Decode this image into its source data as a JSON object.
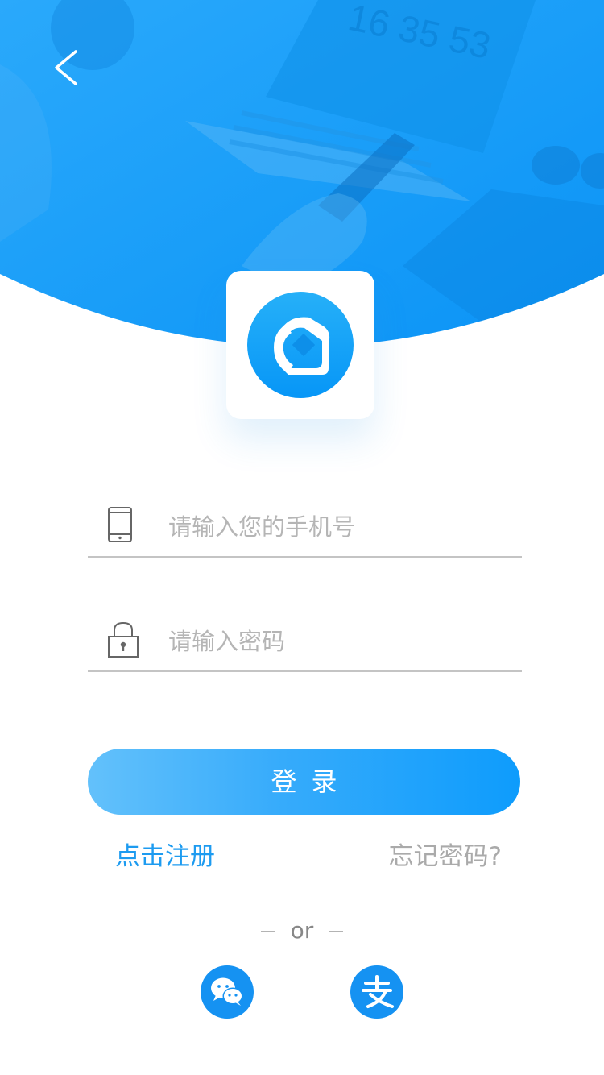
{
  "hero": {
    "background_clock_text": "16 35 53",
    "background_color": "#1a9ffa"
  },
  "header": {
    "back_icon": "chevron-left-icon"
  },
  "logo": {
    "icon": "app-logo-icon",
    "color": "#119df9"
  },
  "form": {
    "phone": {
      "icon": "mobile-phone-icon",
      "placeholder": "请输入您的手机号",
      "value": ""
    },
    "password": {
      "icon": "lock-icon",
      "placeholder": "请输入密码",
      "value": ""
    },
    "login_label": "登录",
    "register_label": "点击注册",
    "forgot_label": "忘记密码?"
  },
  "divider": {
    "text": "or"
  },
  "social": {
    "wechat_icon": "wechat-icon",
    "alipay_icon": "alipay-icon",
    "color": "#1592f2"
  },
  "colors": {
    "accent": "#1d9bf0",
    "button_gradient_start": "#63c1fb",
    "button_gradient_end": "#0e9cfc"
  }
}
